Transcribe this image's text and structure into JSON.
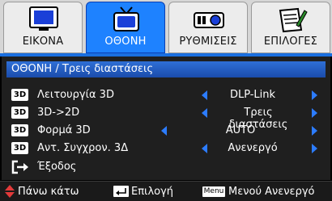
{
  "tabs": [
    {
      "label": "ΕΙΚΟΝΑ",
      "icon": "monitor-icon",
      "active": false
    },
    {
      "label": "ΟΘΟΝΗ",
      "icon": "tv-icon",
      "active": true
    },
    {
      "label": "ΡΥΘΜΙΣΕΙΣ",
      "icon": "projector-icon",
      "active": false
    },
    {
      "label": "ΕΠΙΛΟΓΕΣ",
      "icon": "notepad-pencil-icon",
      "active": false
    }
  ],
  "breadcrumb": "ΟΘΟΝΗ / Τρεις διαστάσεις",
  "menu": [
    {
      "badge": "3D",
      "label": "Λειτουργία 3D",
      "value": "DLP-Link"
    },
    {
      "badge": "3D",
      "label": "3D->2D",
      "value": "Τρεις διαστάσεις"
    },
    {
      "badge": "3D",
      "label": "Φορμά 3D",
      "value": "AUTO"
    },
    {
      "badge": "3D",
      "label": "Αντ. Συγχρον. 3Δ",
      "value": "Ανενεργό"
    },
    {
      "label": "Έξοδος",
      "icon": "exit-icon"
    }
  ],
  "footer": {
    "nav_label": "Πάνω κάτω",
    "enter_label": "Επιλογή",
    "menu_key": "Menu",
    "menu_label": "Μενού Ανενεργό"
  },
  "colors": {
    "accent": "#1e82ff",
    "arrow": "#2c7cff",
    "panel": "#1f1f1f"
  }
}
